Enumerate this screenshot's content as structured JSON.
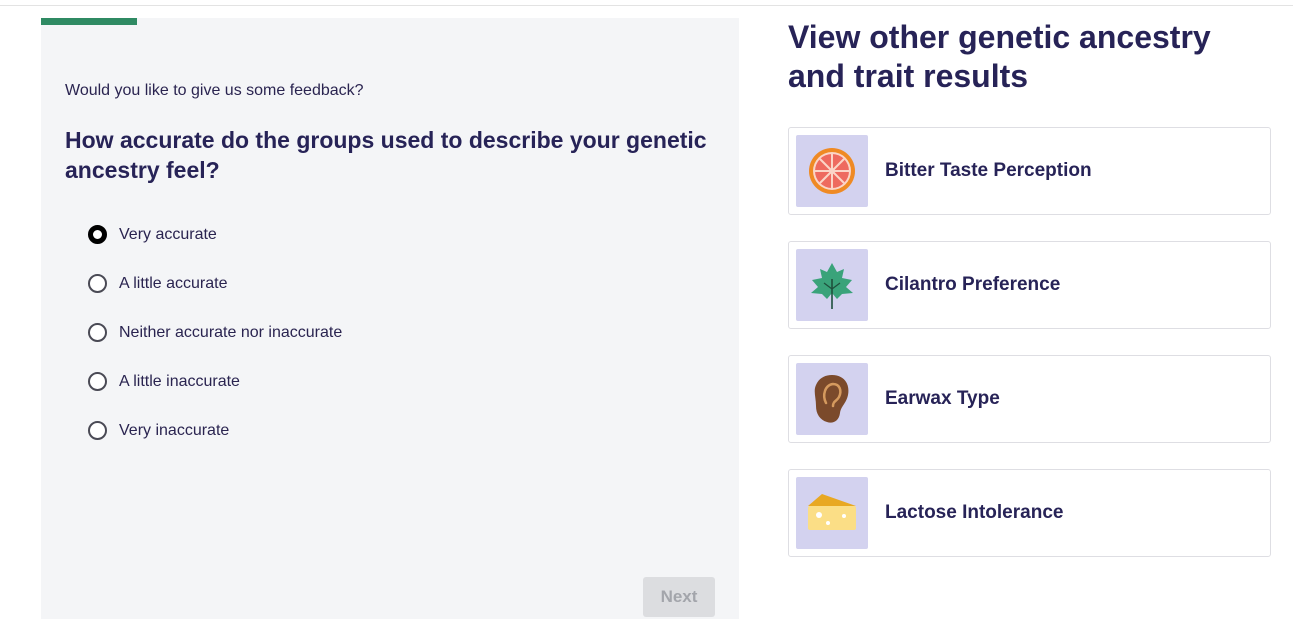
{
  "survey": {
    "progress_fraction": 0.137,
    "prompt": "Would you like to give us some feedback?",
    "question": "How accurate do the groups used to describe your genetic ancestry feel?",
    "options": [
      {
        "label": "Very accurate",
        "selected": true
      },
      {
        "label": "A little accurate",
        "selected": false
      },
      {
        "label": "Neither accurate nor inaccurate",
        "selected": false
      },
      {
        "label": "A little inaccurate",
        "selected": false
      },
      {
        "label": "Very inaccurate",
        "selected": false
      }
    ],
    "next_label": "Next"
  },
  "sidebar": {
    "title": "View other genetic ancestry and trait results",
    "traits": [
      {
        "label": "Bitter Taste Perception",
        "icon": "grapefruit-icon"
      },
      {
        "label": "Cilantro Preference",
        "icon": "cilantro-leaf-icon"
      },
      {
        "label": "Earwax Type",
        "icon": "ear-icon"
      },
      {
        "label": "Lactose Intolerance",
        "icon": "cheese-icon"
      }
    ]
  },
  "colors": {
    "progress": "#2f8a63",
    "heading": "#272357",
    "icon_bg": "#d3d2ef",
    "card_bg": "#f4f5f7"
  }
}
